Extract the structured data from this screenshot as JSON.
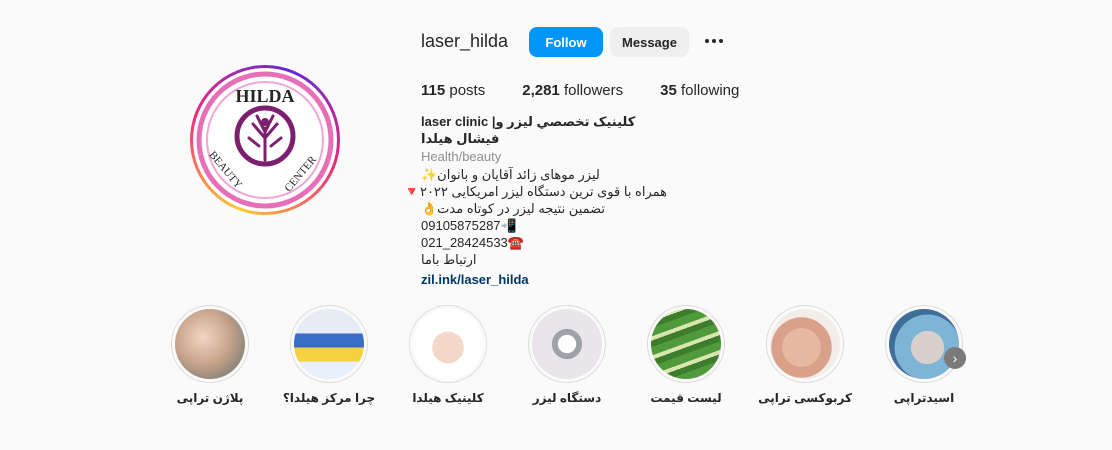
{
  "profile": {
    "username": "laser_hilda",
    "follow_label": "Follow",
    "message_label": "Message",
    "more_icon": "more-options-icon",
    "logo_text_top": "HILDA",
    "logo_text_bottom_left": "BEAUTY",
    "logo_text_bottom_right": "CENTER"
  },
  "stats": {
    "posts_count": "115",
    "posts_label": "posts",
    "followers_count": "2,281",
    "followers_label": "followers",
    "following_count": "35",
    "following_label": "following"
  },
  "bio": {
    "name": "laser clinic |كلينيک تخصصي ليزر و فيشال هيلدا",
    "category": "Health/beauty",
    "lines": [
      "ليزر موهای زائد آقایان و بانوان✨",
      "همراه با قوی ترین دستگاه لیزر امریکایی ۲۰۲۲🔻",
      "تضمین نتیجه لیزر در کوتاه مدت👌",
      "📲09105875287",
      "☎️28424533_021",
      "ارتباط باما"
    ],
    "link": "zil.ink/laser_hilda"
  },
  "highlights": [
    {
      "label": "پلاژن تراپی",
      "color": "#c9a58c"
    },
    {
      "label": "چرا مرکز هیلدا؟",
      "color": "#3a6cc9"
    },
    {
      "label": "کلینیک هیلدا",
      "color": "#f3d8c8"
    },
    {
      "label": "دستگاه لیزر",
      "color": "#e9e5ea"
    },
    {
      "label": "لیست قیمت",
      "color": "#4f9a3a"
    },
    {
      "label": "کربوکسی تراپی",
      "color": "#d9a08a"
    },
    {
      "label": "اسیدتراپی",
      "color": "#7eb4d6"
    }
  ],
  "colors": {
    "follow_blue": "#0095f6",
    "link_blue": "#00376b",
    "logo_purple": "#7b1f6e",
    "logo_pink": "#e76fb7"
  }
}
